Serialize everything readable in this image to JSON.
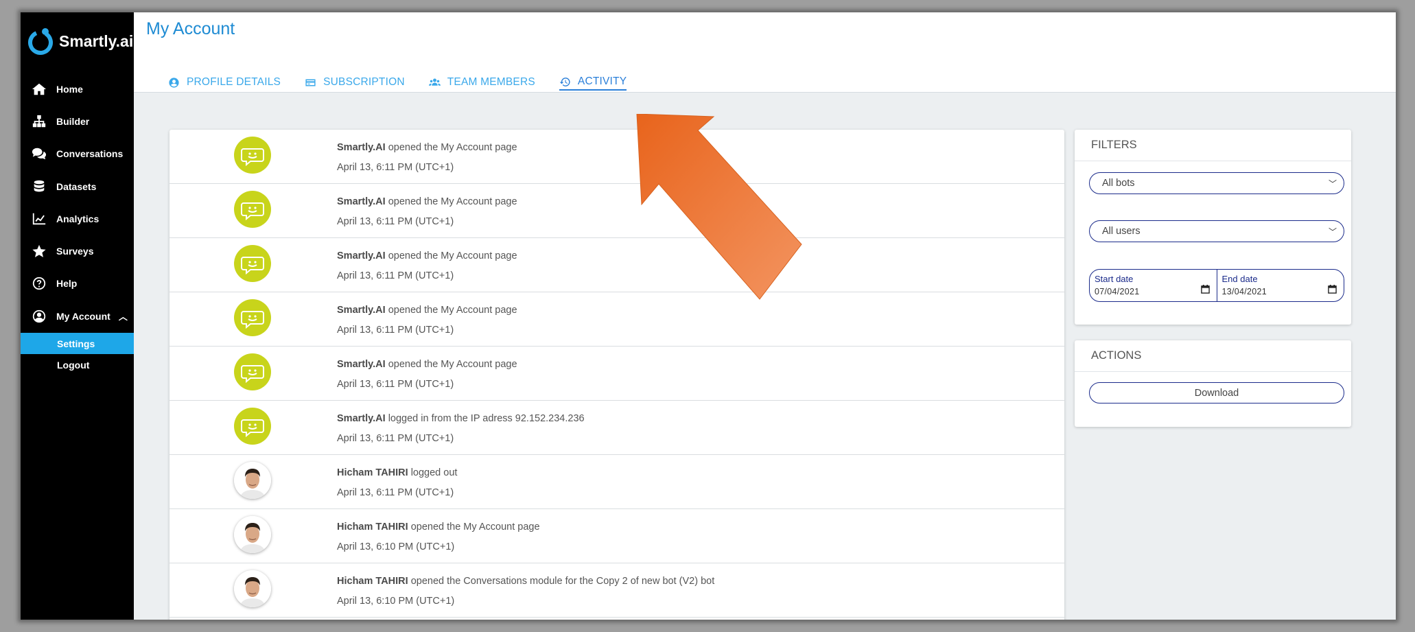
{
  "app": {
    "name": "Smartly.ai"
  },
  "sidebar": {
    "items": [
      {
        "label": "Home",
        "icon": "home-icon"
      },
      {
        "label": "Builder",
        "icon": "sitemap-icon"
      },
      {
        "label": "Conversations",
        "icon": "comments-icon"
      },
      {
        "label": "Datasets",
        "icon": "database-icon"
      },
      {
        "label": "Analytics",
        "icon": "chart-line-icon"
      },
      {
        "label": "Surveys",
        "icon": "star-icon"
      },
      {
        "label": "Help",
        "icon": "question-circle-icon"
      },
      {
        "label": "My Account",
        "icon": "user-circle-icon"
      }
    ],
    "sub_items": [
      {
        "label": "Settings",
        "active": true
      },
      {
        "label": "Logout",
        "active": false
      }
    ]
  },
  "header": {
    "title": "My Account",
    "tabs": [
      {
        "label": "PROFILE DETAILS",
        "icon": "user-circle-icon"
      },
      {
        "label": "SUBSCRIPTION",
        "icon": "credit-card-icon"
      },
      {
        "label": "TEAM MEMBERS",
        "icon": "users-icon"
      },
      {
        "label": "ACTIVITY",
        "icon": "history-icon",
        "active": true
      }
    ]
  },
  "activity": [
    {
      "actor": "Smartly.AI",
      "action": "opened the My Account page",
      "time": "April 13, 6:11 PM (UTC+1)",
      "avatar": "bot"
    },
    {
      "actor": "Smartly.AI",
      "action": "opened the My Account page",
      "time": "April 13, 6:11 PM (UTC+1)",
      "avatar": "bot"
    },
    {
      "actor": "Smartly.AI",
      "action": "opened the My Account page",
      "time": "April 13, 6:11 PM (UTC+1)",
      "avatar": "bot"
    },
    {
      "actor": "Smartly.AI",
      "action": "opened the My Account page",
      "time": "April 13, 6:11 PM (UTC+1)",
      "avatar": "bot"
    },
    {
      "actor": "Smartly.AI",
      "action": "opened the My Account page",
      "time": "April 13, 6:11 PM (UTC+1)",
      "avatar": "bot"
    },
    {
      "actor": "Smartly.AI",
      "action": "logged in from the IP adress 92.152.234.236",
      "time": "April 13, 6:11 PM (UTC+1)",
      "avatar": "bot"
    },
    {
      "actor": "Hicham TAHIRI",
      "action": "logged out",
      "time": "April 13, 6:11 PM (UTC+1)",
      "avatar": "user"
    },
    {
      "actor": "Hicham TAHIRI",
      "action": "opened the My Account page",
      "time": "April 13, 6:10 PM (UTC+1)",
      "avatar": "user"
    },
    {
      "actor": "Hicham TAHIRI",
      "action": "opened the Conversations module for the Copy 2 of new bot (V2) bot",
      "time": "April 13, 6:10 PM (UTC+1)",
      "avatar": "user"
    }
  ],
  "filters": {
    "title": "FILTERS",
    "bots_select": "All bots",
    "users_select": "All users",
    "start_date": {
      "label": "Start date",
      "value": "07/04/2021"
    },
    "end_date": {
      "label": "End date",
      "value": "13/04/2021"
    }
  },
  "actions": {
    "title": "ACTIONS",
    "download_label": "Download"
  },
  "colors": {
    "sidebar_bg": "#000000",
    "accent": "#1ea7e8",
    "tab_color": "#3aa8ea",
    "bot_avatar": "#c8d41b",
    "annotation_arrow": "#f07a2a"
  }
}
